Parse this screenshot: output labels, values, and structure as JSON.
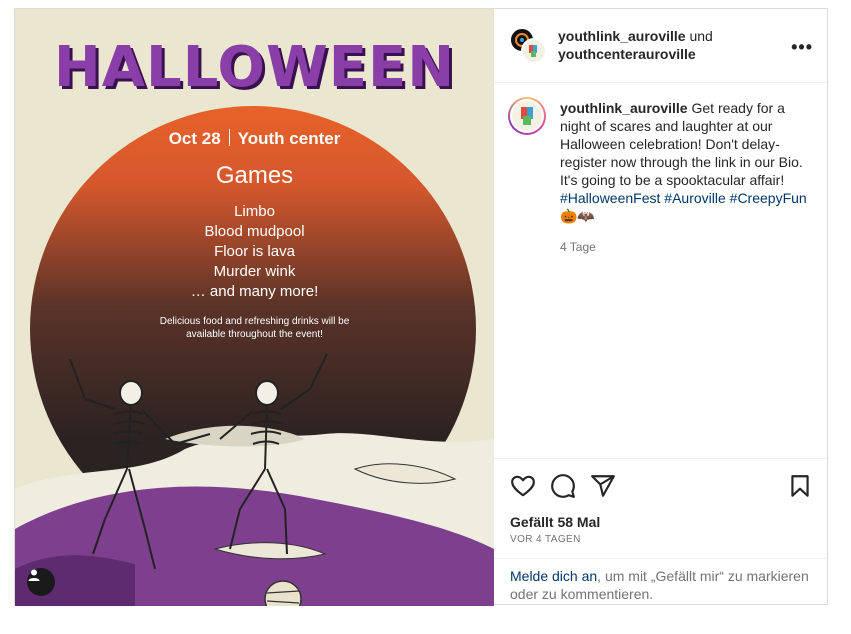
{
  "poster": {
    "title": "HALLOWEEN",
    "date": "Oct 28",
    "venue": "Youth center",
    "games_heading": "Games",
    "games": [
      "Limbo",
      "Blood mudpool",
      "Floor is lava",
      "Murder wink",
      "… and many more!"
    ],
    "note_line1": "Delicious food and refreshing drinks will be",
    "note_line2": "available throughout the event!",
    "colors": {
      "title": "#8a3fa8",
      "sun_top": "#e8622a",
      "sun_bottom": "#2b2222",
      "hill": "#7e3f8f"
    }
  },
  "header": {
    "account1": "youthlink_auroville",
    "connector": "und",
    "account2": "youthcenterauroville",
    "more_icon": "more-horizontal-icon"
  },
  "caption": {
    "username": "youthlink_auroville",
    "text": "Get ready for a night of scares and laughter at our Halloween celebration! Don't delay-register now through the link in our Bio. It's going to be a spooktacular affair!",
    "hashtag1": "#HalloweenFest",
    "hashtag2": "#Auroville",
    "hashtag3": "#CreepyFun",
    "emoji": "🎃🦇",
    "age": "4 Tage"
  },
  "actions": {
    "icons": [
      "heart-icon",
      "comment-icon",
      "share-icon",
      "bookmark-icon"
    ],
    "likes": "Gefällt 58 Mal",
    "date": "VOR 4 TAGEN"
  },
  "login": {
    "link": "Melde dich an",
    "rest": ", um mit „Gefällt mir“ zu markieren oder zu kommentieren."
  }
}
